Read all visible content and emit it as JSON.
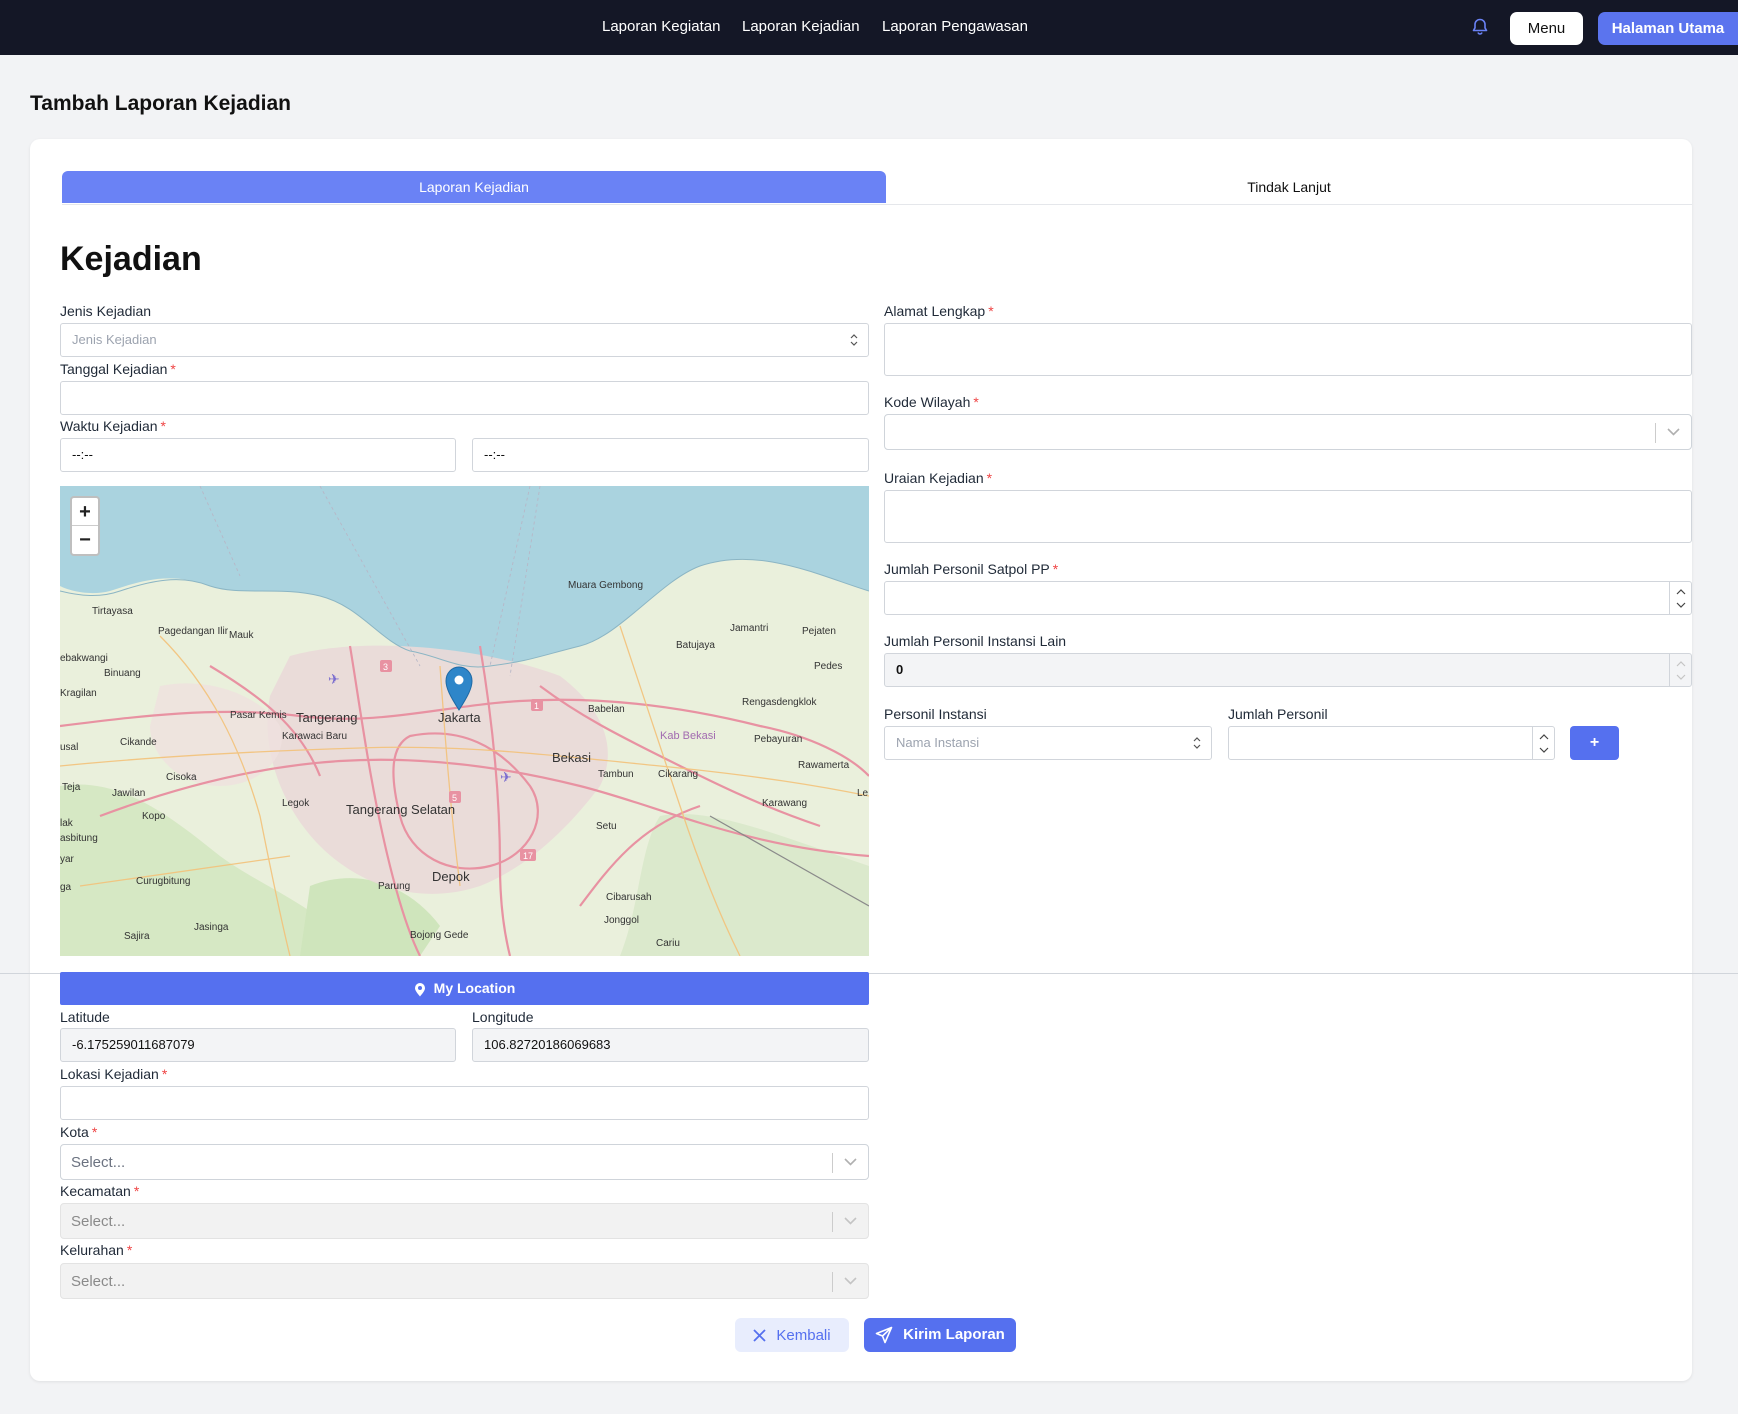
{
  "nav": {
    "links": [
      "Laporan Kegiatan",
      "Laporan Kejadian",
      "Laporan Pengawasan"
    ],
    "menu_label": "Menu",
    "home_label": "Halaman Utama"
  },
  "page_title": "Tambah Laporan Kejadian",
  "tabs": [
    {
      "label": "Laporan Kejadian",
      "active": true
    },
    {
      "label": "Tindak Lanjut",
      "active": false
    }
  ],
  "section_title": "Kejadian",
  "form": {
    "jenis_kejadian": {
      "label": "Jenis Kejadian",
      "placeholder": "Jenis Kejadian"
    },
    "tanggal_kejadian": {
      "label": "Tanggal Kejadian",
      "value": ""
    },
    "waktu_kejadian": {
      "label": "Waktu Kejadian",
      "start": "--:--",
      "end": "--:--"
    },
    "my_location_label": "My Location",
    "latitude": {
      "label": "Latitude",
      "value": "-6.175259011687079"
    },
    "longitude": {
      "label": "Longitude",
      "value": "106.82720186069683"
    },
    "lokasi_kejadian": {
      "label": "Lokasi Kejadian",
      "value": ""
    },
    "kota": {
      "label": "Kota",
      "placeholder": "Select..."
    },
    "kecamatan": {
      "label": "Kecamatan",
      "placeholder": "Select..."
    },
    "kelurahan": {
      "label": "Kelurahan",
      "placeholder": "Select..."
    },
    "alamat_lengkap": {
      "label": "Alamat Lengkap",
      "value": ""
    },
    "kode_wilayah": {
      "label": "Kode Wilayah"
    },
    "uraian_kejadian": {
      "label": "Uraian Kejadian",
      "value": ""
    },
    "jumlah_satpol": {
      "label": "Jumlah Personil Satpol PP",
      "value": ""
    },
    "jumlah_instansi_lain": {
      "label": "Jumlah Personil Instansi Lain",
      "value": "0"
    },
    "personil_instansi": {
      "label": "Personil Instansi",
      "placeholder": "Nama Instansi"
    },
    "jumlah_personil": {
      "label": "Jumlah Personil",
      "value": ""
    },
    "add_label": "+"
  },
  "map": {
    "zoom_in": "+",
    "zoom_out": "−",
    "places": [
      "Muara Gembong",
      "Tirtayasa",
      "Pagedangan Ilir",
      "Mauk",
      "Jamantri",
      "Pejaten",
      "Batujaya",
      "ebakwangi",
      "Binuang",
      "Pedes",
      "Kragilan",
      "Pasar Kemis",
      "Tangerang",
      "Jakarta",
      "Babelan",
      "Rengasdengklok",
      "Karawaci Baru",
      "Kab Bekasi",
      "Pebayuran",
      "Cikande",
      "usal",
      "Bekasi",
      "Rawamerta",
      "Cisoka",
      "Tambun",
      "Cikarang",
      "Teja",
      "Jawilan",
      "Legok",
      "Karawang",
      "Le",
      "Kopo",
      "Tangerang Selatan",
      "Setu",
      "lak",
      "asbitung",
      "yar",
      "Curugbitung",
      "Parung",
      "Depok",
      "Cibarusah",
      "ga",
      "Jonggol",
      "Jasinga",
      "Sajira",
      "Bojong Gede",
      "Cariu"
    ],
    "route_numbers": [
      "3",
      "1",
      "5",
      "17"
    ]
  },
  "actions": {
    "back_label": "Kembali",
    "send_label": "Kirim Laporan"
  },
  "colors": {
    "nav_bg": "#141726",
    "primary": "#5570ef",
    "tab_active": "#6a82f5",
    "required": "#ef4444"
  },
  "icons": [
    "bell-icon",
    "chevron-updown-icon",
    "chevron-down-icon",
    "location-pin-icon",
    "close-icon",
    "send-icon",
    "map-marker-icon"
  ]
}
